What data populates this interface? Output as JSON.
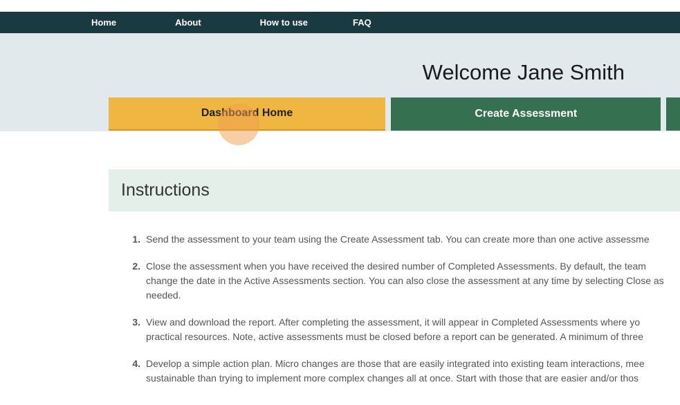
{
  "nav": {
    "items": [
      {
        "label": "Home"
      },
      {
        "label": "About"
      },
      {
        "label": "How to use"
      },
      {
        "label": "FAQ"
      }
    ]
  },
  "welcome": {
    "text": "Welcome Jane Smith"
  },
  "tabs": {
    "active": "Dashboard Home",
    "inactive": "Create Assessment"
  },
  "instructions": {
    "header": "Instructions",
    "items": [
      {
        "number": "1.",
        "text": "Send the assessment to your team using the Create Assessment tab. You can create more than one active assessme"
      },
      {
        "number": "2.",
        "text": "Close the assessment when you have received the desired number of Completed Assessments. By default, the team change the date in the Active Assessments section. You can also close the assessment at any time by selecting Close as needed."
      },
      {
        "number": "3.",
        "text": "View and download the report. After completing the assessment, it will appear in Completed Assessments where yo practical resources. Note, active assessments must be closed before a report can be generated. A minimum of three"
      },
      {
        "number": "4.",
        "text": "Develop a simple action plan. Micro changes are those that are easily integrated into existing team interactions, mee sustainable than trying to implement more complex changes all at once. Start with those that are easier and/or thos"
      }
    ]
  }
}
